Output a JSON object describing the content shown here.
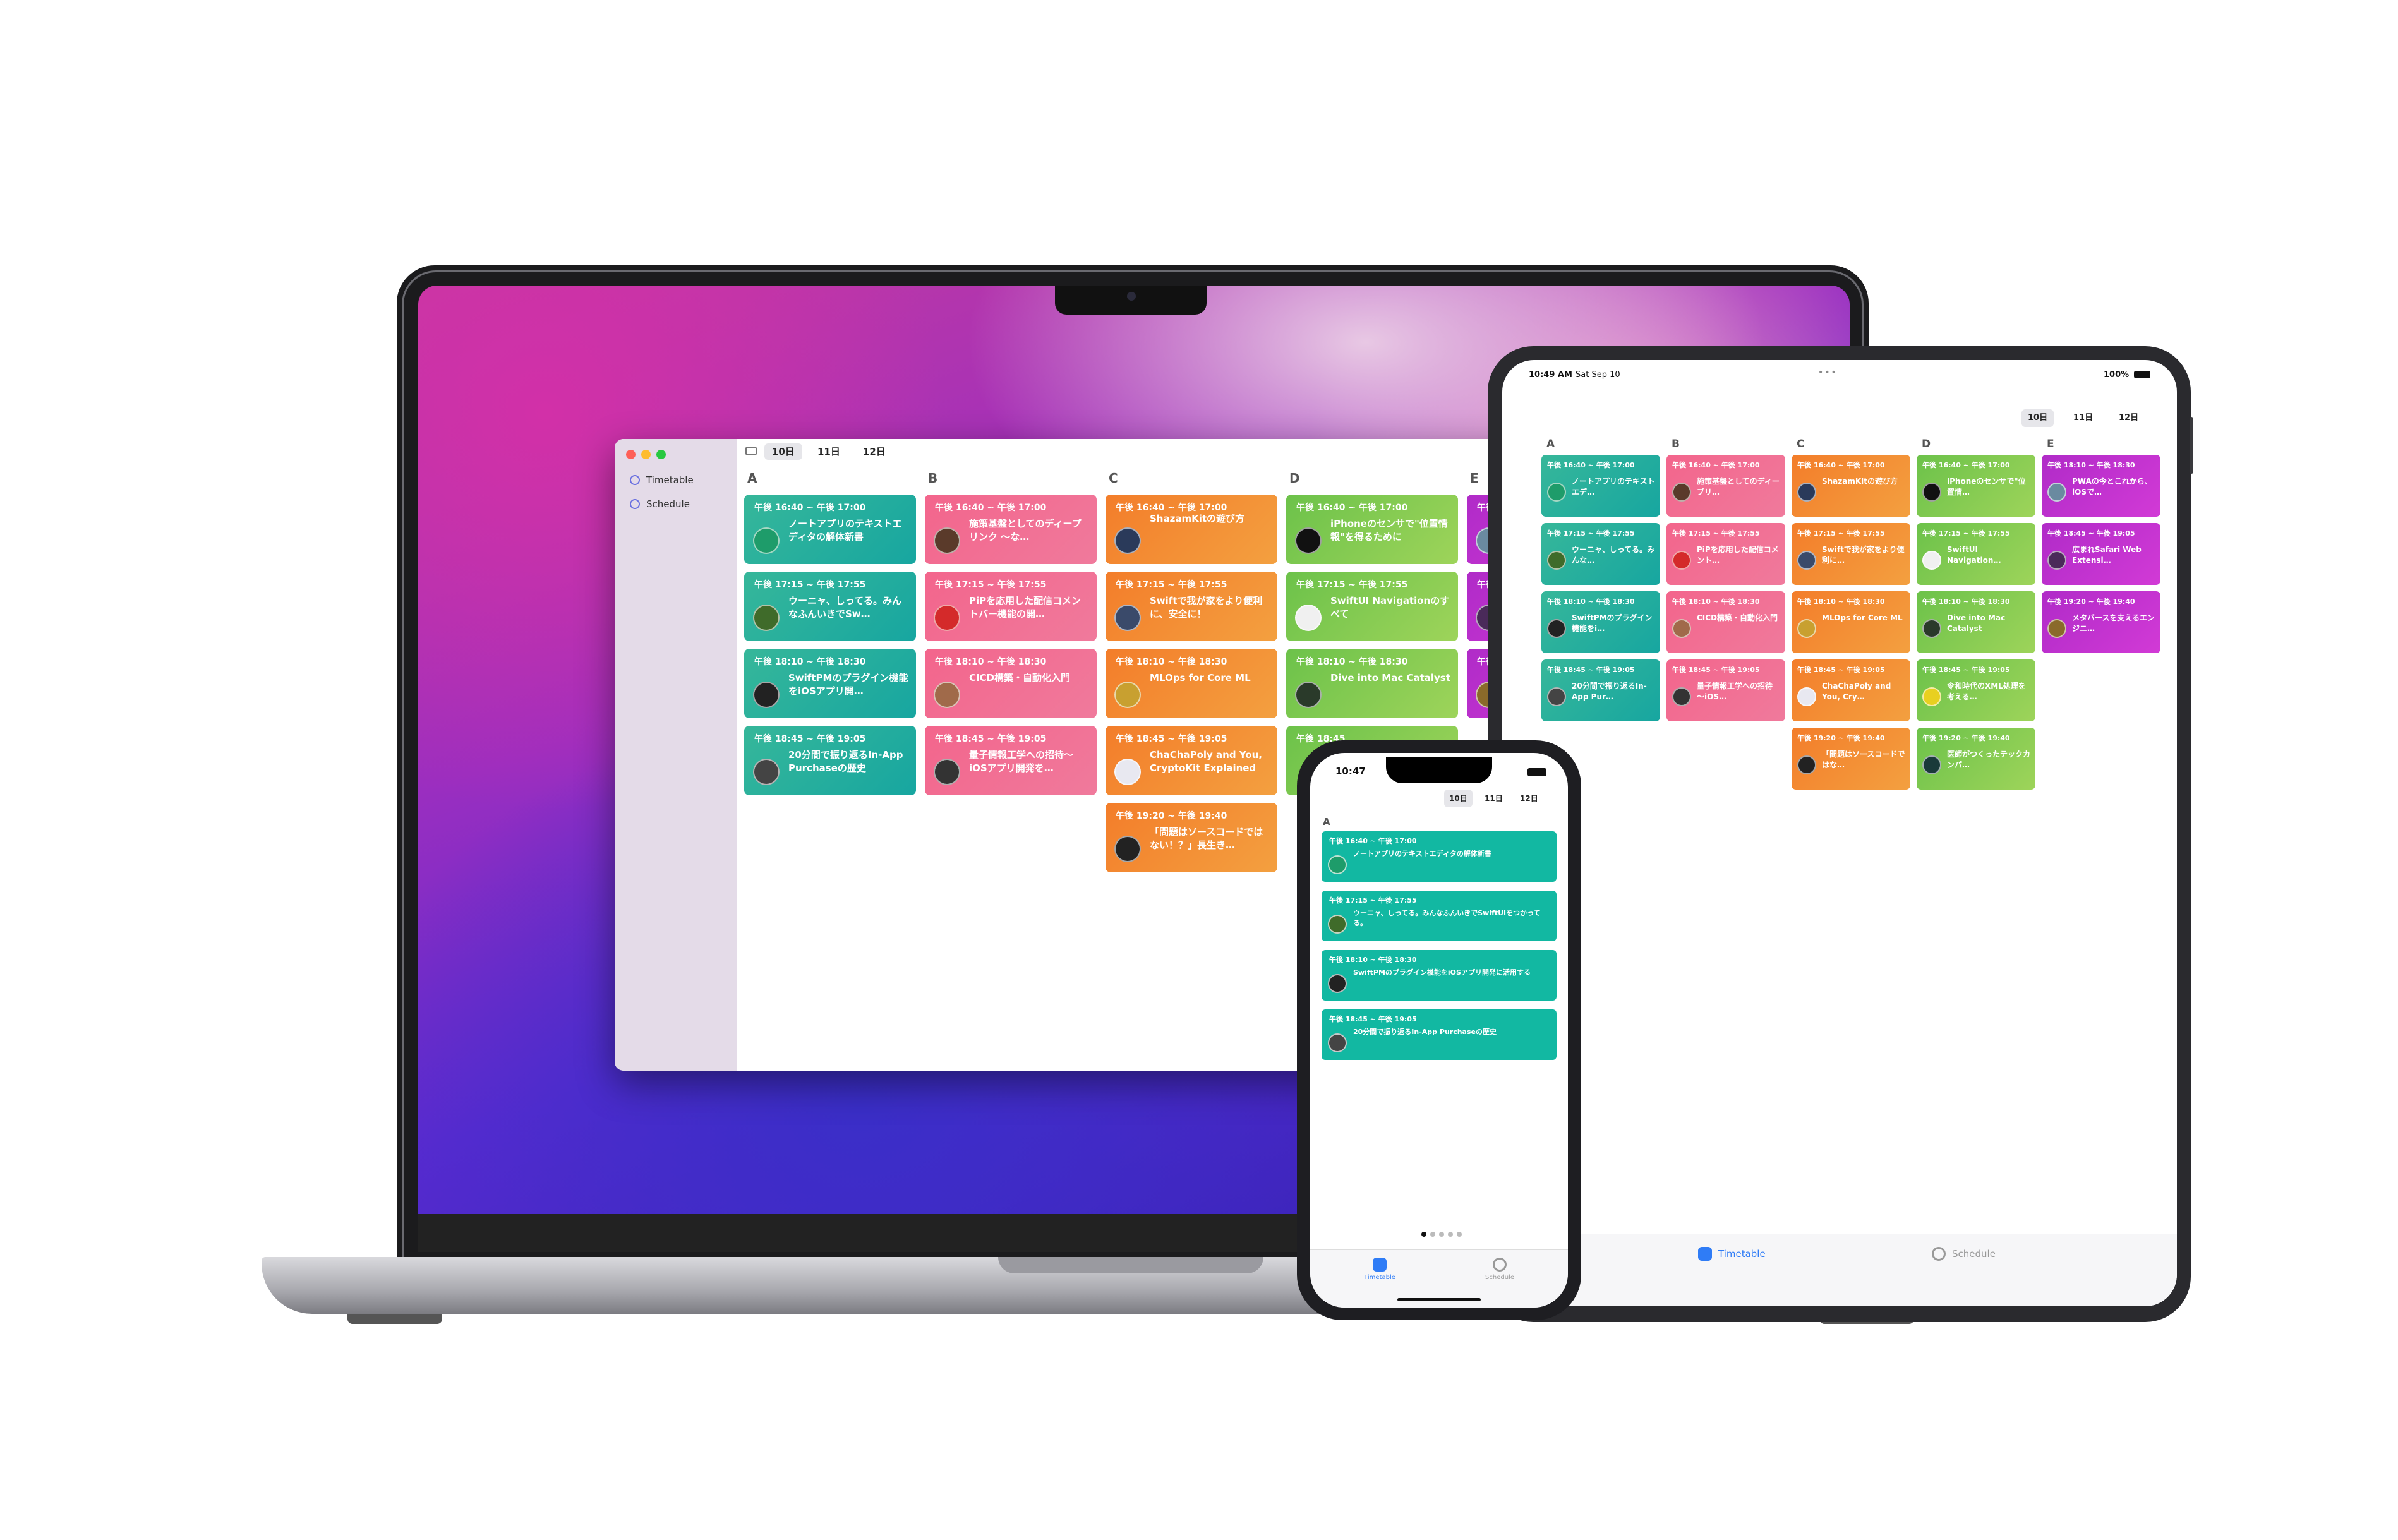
{
  "mac": {
    "sidebar": {
      "items": [
        {
          "label": "Timetable"
        },
        {
          "label": "Schedule"
        }
      ]
    },
    "toolbar": {
      "days": [
        "10日",
        "11日",
        "12日"
      ]
    },
    "columns": [
      "A",
      "B",
      "C",
      "D",
      "E"
    ],
    "cards": {
      "A": [
        {
          "time": "午後 16:40 ~ 午後 17:00",
          "title": "ノートアプリのテキストエディタの解体新書"
        },
        {
          "time": "午後 17:15 ~ 午後 17:55",
          "title": "ウーニャ、しってる。みんなふんいきでSw…"
        },
        {
          "time": "午後 18:10 ~ 午後 18:30",
          "title": "SwiftPMのプラグイン機能をiOSアプリ開…"
        },
        {
          "time": "午後 18:45 ~ 午後 19:05",
          "title": "20分間で振り返るIn-App Purchaseの歴史"
        }
      ],
      "B": [
        {
          "time": "午後 16:40 ~ 午後 17:00",
          "title": "施策基盤としてのディープリンク 〜な…"
        },
        {
          "time": "午後 17:15 ~ 午後 17:55",
          "title": "PiPを応用した配信コメントバー機能の開…"
        },
        {
          "time": "午後 18:10 ~ 午後 18:30",
          "title": "CICD構築・自動化入門"
        },
        {
          "time": "午後 18:45 ~ 午後 19:05",
          "title": "量子情報工学への招待〜iOSアプリ開発を…"
        }
      ],
      "C": [
        {
          "time": "午後 16:40 ~ 午後 17:00",
          "title": "ShazamKitの遊び方"
        },
        {
          "time": "午後 17:15 ~ 午後 17:55",
          "title": "Swiftで我が家をより便利に、安全に！"
        },
        {
          "time": "午後 18:10 ~ 午後 18:30",
          "title": "MLOps for Core ML"
        },
        {
          "time": "午後 18:45 ~ 午後 19:05",
          "title": "ChaChaPoly and You, CryptoKit Explained"
        },
        {
          "time": "午後 19:20 ~ 午後 19:40",
          "title": "「問題はソースコードではない！？」長生き…"
        }
      ],
      "D": [
        {
          "time": "午後 16:40 ~ 午後 17:00",
          "title": "iPhoneのセンサで\"位置情報\"を得るために"
        },
        {
          "time": "午後 17:15 ~ 午後 17:55",
          "title": "SwiftUI Navigationのすべて"
        },
        {
          "time": "午後 18:10 ~ 午後 18:30",
          "title": "Dive into Mac Catalyst"
        },
        {
          "time": "午後 18:45",
          "title": ""
        }
      ],
      "E": [
        {
          "time": "午後",
          "title": ""
        },
        {
          "time": "午後",
          "title": ""
        },
        {
          "time": "午後",
          "title": ""
        }
      ]
    }
  },
  "ipad": {
    "status": {
      "time": "10:49 AM",
      "date": "Sat Sep 10",
      "battery": "100%"
    },
    "days": [
      "10日",
      "11日",
      "12日"
    ],
    "columns": [
      "A",
      "B",
      "C",
      "D",
      "E"
    ],
    "cards": {
      "A": [
        {
          "time": "午後 16:40 ~ 午後 17:00",
          "title": "ノートアプリのテキストエデ…"
        },
        {
          "time": "午後 17:15 ~ 午後 17:55",
          "title": "ウーニャ、しってる。みんな…"
        },
        {
          "time": "午後 18:10 ~ 午後 18:30",
          "title": "SwiftPMのプラグイン機能をi…"
        },
        {
          "time": "午後 18:45 ~ 午後 19:05",
          "title": "20分間で振り返るIn-App Pur…"
        }
      ],
      "B": [
        {
          "time": "午後 16:40 ~ 午後 17:00",
          "title": "施策基盤としてのディープリ…"
        },
        {
          "time": "午後 17:15 ~ 午後 17:55",
          "title": "PiPを応用した配信コメント…"
        },
        {
          "time": "午後 18:10 ~ 午後 18:30",
          "title": "CICD構築・自動化入門"
        },
        {
          "time": "午後 18:45 ~ 午後 19:05",
          "title": "量子情報工学への招待 〜iOS…"
        }
      ],
      "C": [
        {
          "time": "午後 16:40 ~ 午後 17:00",
          "title": "ShazamKitの遊び方"
        },
        {
          "time": "午後 17:15 ~ 午後 17:55",
          "title": "Swiftで我が家をより便利に…"
        },
        {
          "time": "午後 18:10 ~ 午後 18:30",
          "title": "MLOps for Core ML"
        },
        {
          "time": "午後 18:45 ~ 午後 19:05",
          "title": "ChaChaPoly and You, Cry…"
        },
        {
          "time": "午後 19:20 ~ 午後 19:40",
          "title": "「問題はソースコードではな…"
        }
      ],
      "D": [
        {
          "time": "午後 16:40 ~ 午後 17:00",
          "title": "iPhoneのセンサで\"位置情…"
        },
        {
          "time": "午後 17:15 ~ 午後 17:55",
          "title": "SwiftUI Navigation…"
        },
        {
          "time": "午後 18:10 ~ 午後 18:30",
          "title": "Dive into Mac Catalyst"
        },
        {
          "time": "午後 18:45 ~ 午後 19:05",
          "title": "令和時代のXML処理を考える…"
        },
        {
          "time": "午後 19:20 ~ 午後 19:40",
          "title": "医師がつくったテックカンパ…"
        }
      ],
      "E": [
        {
          "time": "午後 18:10 ~ 午後 18:30",
          "title": "PWAの今とこれから、iOSで…"
        },
        {
          "time": "午後 18:45 ~ 午後 19:05",
          "title": "広まれSafari Web Extensi…"
        },
        {
          "time": "午後 19:20 ~ 午後 19:40",
          "title": "メタバースを支えるエンジニ…"
        }
      ]
    },
    "tabs": [
      {
        "label": "Timetable"
      },
      {
        "label": "Schedule"
      }
    ]
  },
  "iphone": {
    "status": {
      "time": "10:47"
    },
    "days": [
      "10日",
      "11日",
      "12日"
    ],
    "column": "A",
    "cards": [
      {
        "time": "午後 16:40 ~ 午後 17:00",
        "title": "ノートアプリのテキストエディタの解体新書"
      },
      {
        "time": "午後 17:15 ~ 午後 17:55",
        "title": "ウーニャ、しってる。みんなふんいきでSwiftUIをつかってる。"
      },
      {
        "time": "午後 18:10 ~ 午後 18:30",
        "title": "SwiftPMのプラグイン機能をiOSアプリ開発に活用する"
      },
      {
        "time": "午後 18:45 ~ 午後 19:05",
        "title": "20分間で振り返るIn-App Purchaseの歴史"
      }
    ],
    "tabs": [
      {
        "label": "Timetable"
      },
      {
        "label": "Schedule"
      }
    ]
  },
  "colors": {
    "teal": "#17a6a0",
    "pink": "#f3658c",
    "orange": "#f37d2a",
    "green": "#6cc24a",
    "purple": "#b02bc8",
    "accent": "#2f7cf6"
  }
}
